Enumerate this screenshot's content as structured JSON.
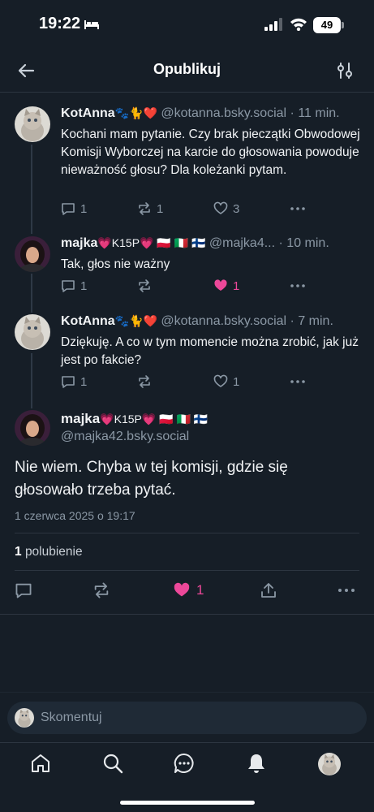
{
  "status_bar": {
    "time": "19:22",
    "battery": "49"
  },
  "header": {
    "title": "Opublikuj"
  },
  "posts": [
    {
      "name": "KotAnna",
      "name_emoji": "🐾🐈❤️",
      "handle": "@kotanna.bsky.social",
      "time": "· 11 min.",
      "text": "Kochani mam pytanie. Czy brak pieczątki Obwodowej Komisji Wyborczej na karcie do głosowania powoduje nieważność głosu? Dla koleżanki pytam.",
      "replies": "1",
      "reposts": "1",
      "likes": "3"
    },
    {
      "name": "majka",
      "name_emoji": "💗K15P💗 🇵🇱 🇮🇹 🇫🇮",
      "handle": "@majka4...",
      "time": "· 10 min.",
      "text": "Tak, głos nie ważny",
      "replies": "1",
      "reposts": "",
      "likes": "1"
    },
    {
      "name": "KotAnna",
      "name_emoji": "🐾🐈❤️",
      "handle": "@kotanna.bsky.social",
      "time": "· 7 min.",
      "text": "Dziękuję. A co w tym momencie można zrobić, jak już jest po fakcie?",
      "replies": "1",
      "reposts": "",
      "likes": "1"
    }
  ],
  "main_post": {
    "name": "majka",
    "name_emoji": "💗K15P💗 🇵🇱 🇮🇹 🇫🇮",
    "handle": "@majka42.bsky.social",
    "text": "Nie wiem. Chyba w tej komisji, gdzie się głosowało trzeba pytać.",
    "date": "1 czerwca 2025 o 19:17",
    "likes_count": "1",
    "likes_label": "polubienie",
    "like_action_count": "1"
  },
  "comment": {
    "placeholder": "Skomentuj"
  },
  "colors": {
    "background": "#161e27",
    "accent_like": "#ec4899",
    "muted": "#8b98a5"
  },
  "icons": [
    "back-arrow-icon",
    "filter-icon",
    "reply-icon",
    "repost-icon",
    "heart-icon",
    "more-icon",
    "share-icon",
    "home-icon",
    "search-icon",
    "chat-icon",
    "bell-icon"
  ]
}
